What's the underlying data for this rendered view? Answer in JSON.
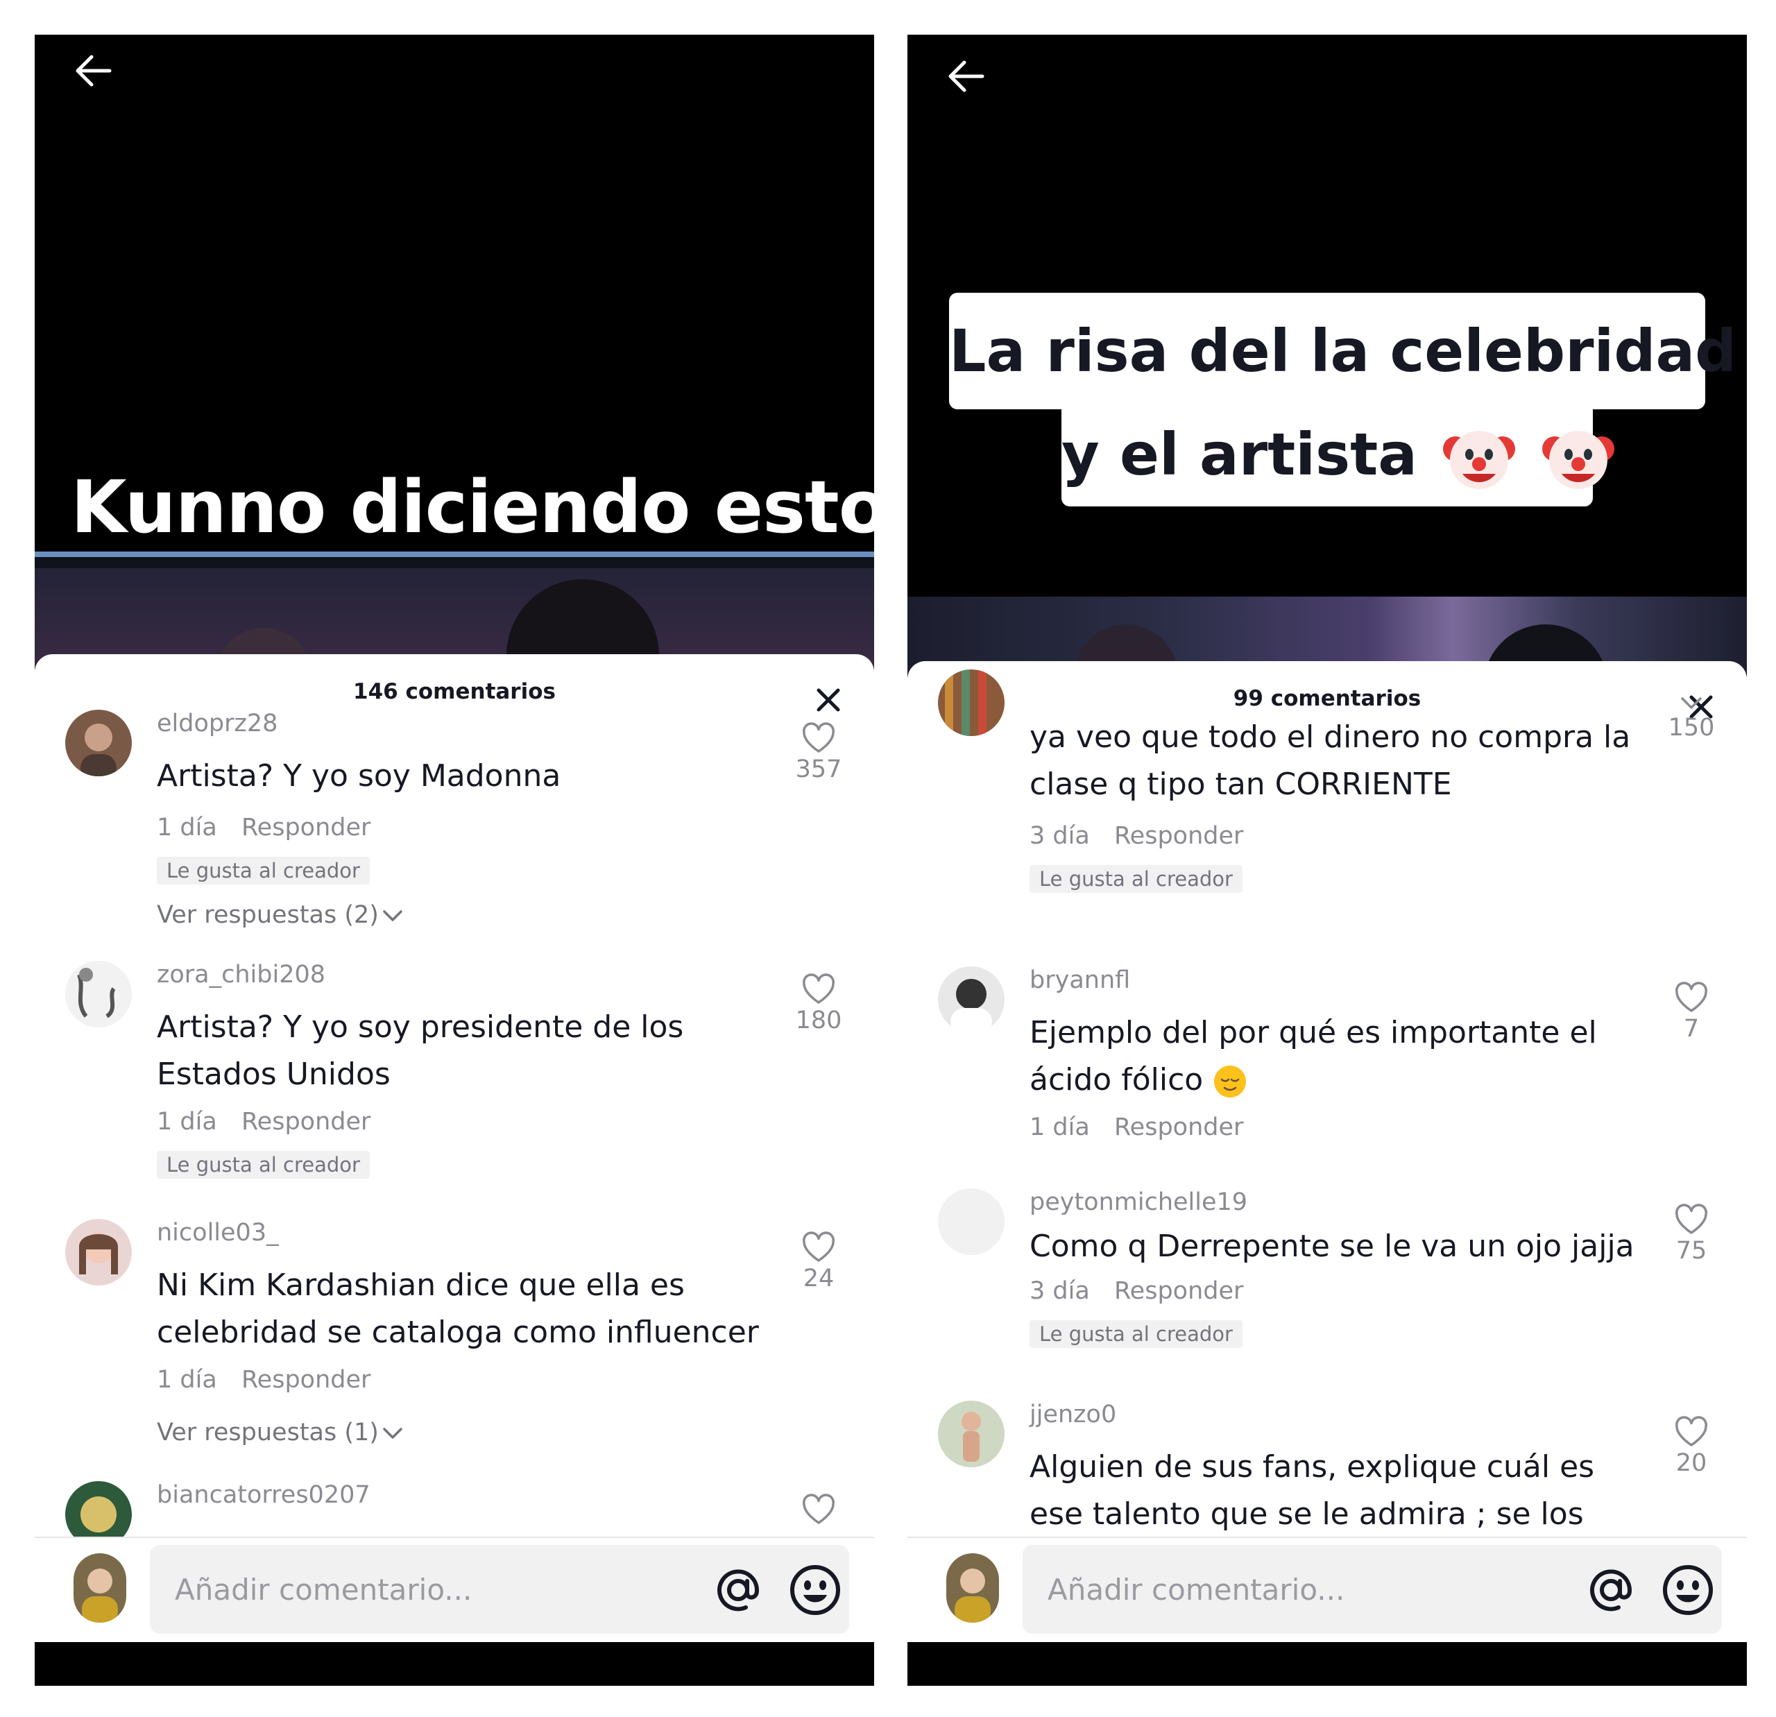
{
  "left": {
    "caption": "Kunno diciendo esto:",
    "comments_count": "146 comentarios",
    "comments": [
      {
        "username": "eldoprz28",
        "text": "Artista? Y yo soy Madonna",
        "time": "1 día",
        "reply": "Responder",
        "badge": "Le gusta al creador",
        "likes": "357",
        "view_replies": "Ver respuestas (2)"
      },
      {
        "username": "zora_chibi208",
        "text": "Artista? Y yo soy presidente de los Estados Unidos",
        "time": "1 día",
        "reply": "Responder",
        "badge": "Le gusta al creador",
        "likes": "180"
      },
      {
        "username": "nicolle03_",
        "text": "Ni Kim Kardashian dice que ella es celebridad se cataloga como influencer",
        "time": "1 día",
        "reply": "Responder",
        "likes": "24",
        "view_replies": "Ver respuestas (1)"
      },
      {
        "username": "biancatorres0207"
      }
    ],
    "input_placeholder": "Añadir comentario..."
  },
  "right": {
    "caption_line1": "La risa del la celebridad",
    "caption_line2": "y el artista",
    "caption_emoji": "clown-face-icon ×2",
    "comments_count": "99 comentarios",
    "comments": [
      {
        "text": "ya veo que todo el dinero no compra la clase q tipo tan CORRIENTE",
        "time": "3 día",
        "reply": "Responder",
        "badge": "Le gusta al creador",
        "likes": "150"
      },
      {
        "username": "bryannfl",
        "text": "Ejemplo del por qué es importante el ácido fólico",
        "time": "1 día",
        "reply": "Responder",
        "likes": "7"
      },
      {
        "username": "peytonmichelle19",
        "text": "Como q Derrepente se le va un ojo jajja",
        "time": "3 día",
        "reply": "Responder",
        "badge": "Le gusta al creador",
        "likes": "75"
      },
      {
        "username": "jjenzo0",
        "text": "Alguien de sus fans, explique cuál es ese talento que se le admira ; se los suplico !",
        "likes": "20"
      }
    ],
    "input_placeholder": "Añadir comentario..."
  },
  "colors": {
    "text": "#161823",
    "muted": "#8a8b91",
    "badge_bg": "#f1f1f2",
    "sheet_bg": "#ffffff",
    "video_bg": "#000000"
  }
}
